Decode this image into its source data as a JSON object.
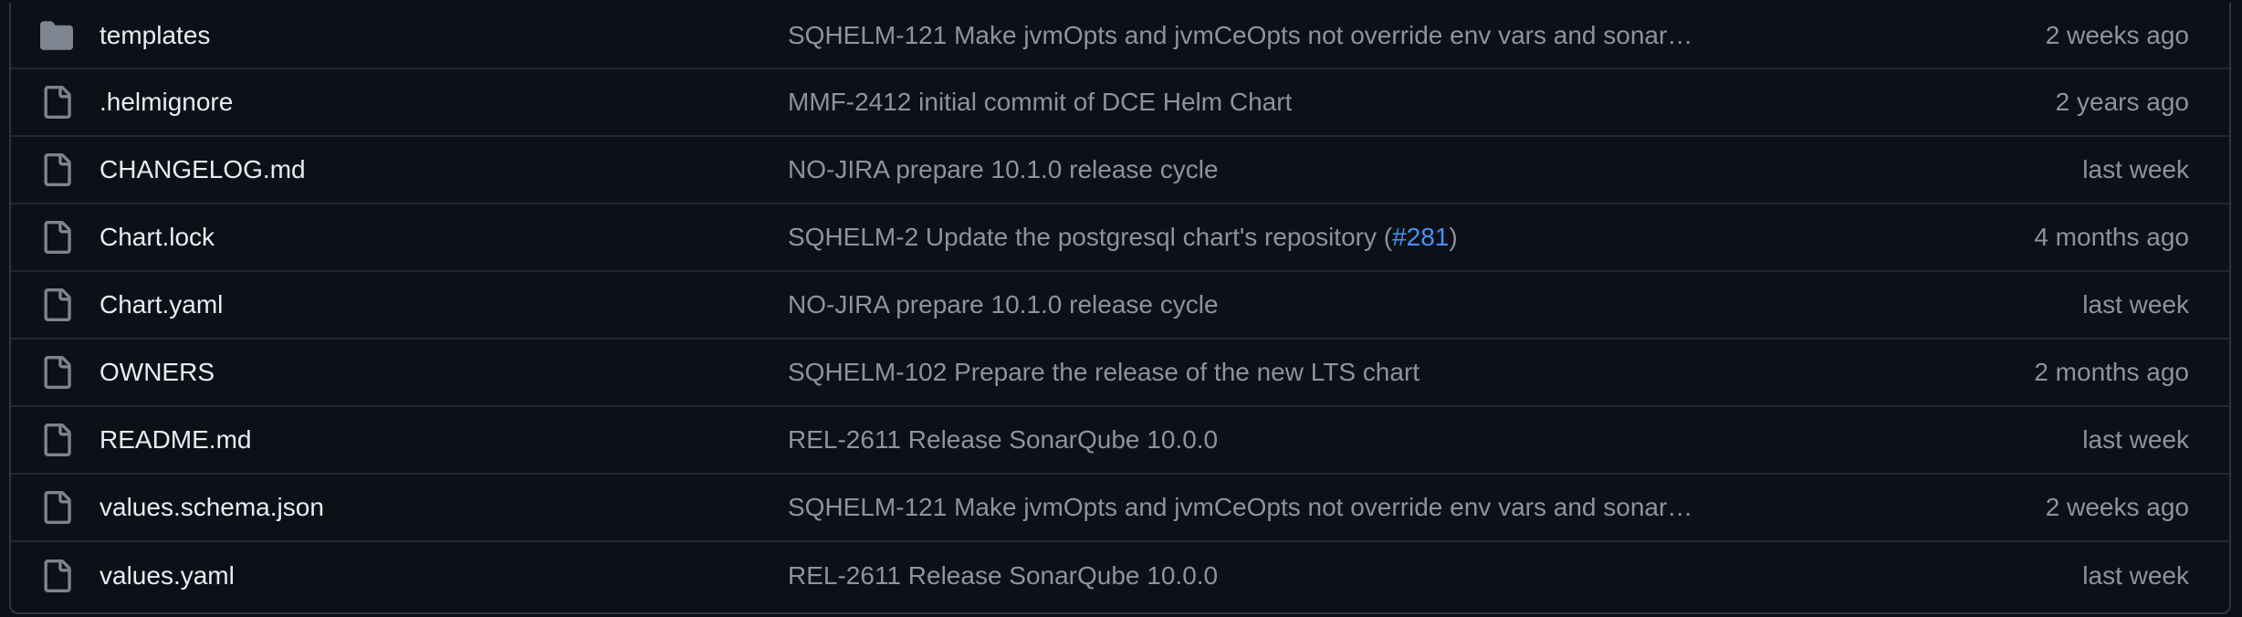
{
  "colors": {
    "background": "#0d1117",
    "border": "#30363d",
    "name_text": "#e6edf3",
    "muted_text": "#8b949e",
    "link": "#4493f8",
    "folder_icon": "#7d8590"
  },
  "files": [
    {
      "icon": "folder-icon",
      "name": "templates",
      "message": "SQHELM-121 Make jvmOpts and jvmCeOpts not override env vars and sonar…",
      "age": "2 weeks ago"
    },
    {
      "icon": "file-icon",
      "name": ".helmignore",
      "message": "MMF-2412 initial commit of DCE Helm Chart",
      "age": "2 years ago"
    },
    {
      "icon": "file-icon",
      "name": "CHANGELOG.md",
      "message": "NO-JIRA prepare 10.1.0 release cycle",
      "age": "last week"
    },
    {
      "icon": "file-icon",
      "name": "Chart.lock",
      "message_pre": "SQHELM-2 Update the postgresql chart's repository (",
      "message_link": "#281",
      "message_post": ")",
      "age": "4 months ago"
    },
    {
      "icon": "file-icon",
      "name": "Chart.yaml",
      "message": "NO-JIRA prepare 10.1.0 release cycle",
      "age": "last week"
    },
    {
      "icon": "file-icon",
      "name": "OWNERS",
      "message": "SQHELM-102 Prepare the release of the new LTS chart",
      "age": "2 months ago"
    },
    {
      "icon": "file-icon",
      "name": "README.md",
      "message": "REL-2611 Release SonarQube 10.0.0",
      "age": "last week"
    },
    {
      "icon": "file-icon",
      "name": "values.schema.json",
      "message": "SQHELM-121 Make jvmOpts and jvmCeOpts not override env vars and sonar…",
      "age": "2 weeks ago"
    },
    {
      "icon": "file-icon",
      "name": "values.yaml",
      "message": "REL-2611 Release SonarQube 10.0.0",
      "age": "last week"
    }
  ]
}
